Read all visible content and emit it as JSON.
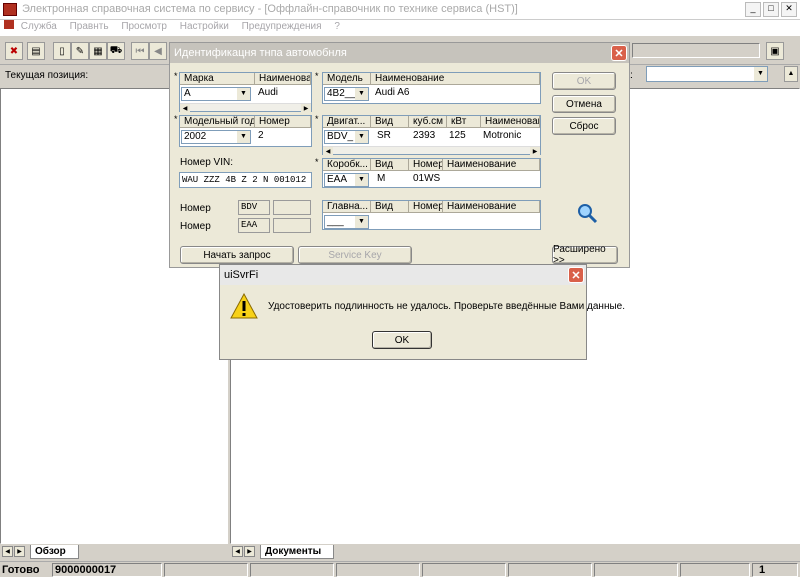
{
  "window": {
    "title": "Электронная справочная система по сервису - [Оффлайн-справочник по технике сервиса (HST)]"
  },
  "menu": [
    "Служба",
    "Правнть",
    "Просмотр",
    "Настройки",
    "Предупреждения",
    "?"
  ],
  "left_panel": {
    "position_label": "Текущая позиция:",
    "tab_label": "Обзор"
  },
  "right_panel": {
    "field_label_suffix": "ка:",
    "tab_label": "Документы"
  },
  "dialog": {
    "title": "Идентификацня тнпа автомобнля",
    "marka": {
      "headers": [
        "Марка",
        "Наименование"
      ],
      "value": "A",
      "name": "Audi"
    },
    "model": {
      "headers": [
        "Модель",
        "Наименование"
      ],
      "value": "4B2___",
      "name": "Audi A6"
    },
    "year": {
      "headers": [
        "Модельный год",
        "Номер"
      ],
      "value": "2002",
      "number": "2"
    },
    "engine": {
      "headers": [
        "Двигат...",
        "Вид",
        "куб.см",
        "кВт",
        "Наименование"
      ],
      "value": "BDV_",
      "vid": "SR",
      "cc": "2393",
      "kw": "125",
      "name": "Motronic"
    },
    "gearbox": {
      "headers": [
        "Коробк...",
        "Вид",
        "Номер",
        "Наименование"
      ],
      "value": "EAA",
      "vid": "M",
      "number": "01WS"
    },
    "main_gear": {
      "headers": [
        "Главна...",
        "Вид",
        "Номер",
        "Наименование"
      ],
      "value": "___"
    },
    "vin_label": "Номер VIN:",
    "vin_value": "WAU ZZZ 4B Z 2 N 001012",
    "number1_label": "Номер",
    "number1_value": "BDV",
    "number2_label": "Номер",
    "number2_value": "EAA",
    "ok_label": "OK",
    "cancel_label": "Отмена",
    "reset_label": "Сброс",
    "start_label": "Начать запрос",
    "service_key_label": "Service Key",
    "extended_label": "Расширено >>"
  },
  "alert": {
    "title": "uiSvrFi",
    "message": "Удостоверить подлинность не удалось. Проверьте введённые Вами данные.",
    "ok_label": "OK"
  },
  "status": {
    "ready": "Готово",
    "code": "9000000017",
    "page": "1"
  },
  "icons": [
    "app-icon",
    "toolbar-icons",
    "warning-icon",
    "search-icon"
  ],
  "colors": {
    "dialog_title": "#c6c3bc",
    "alert_title": "#e8e8e8",
    "warning": "#f7d117"
  }
}
